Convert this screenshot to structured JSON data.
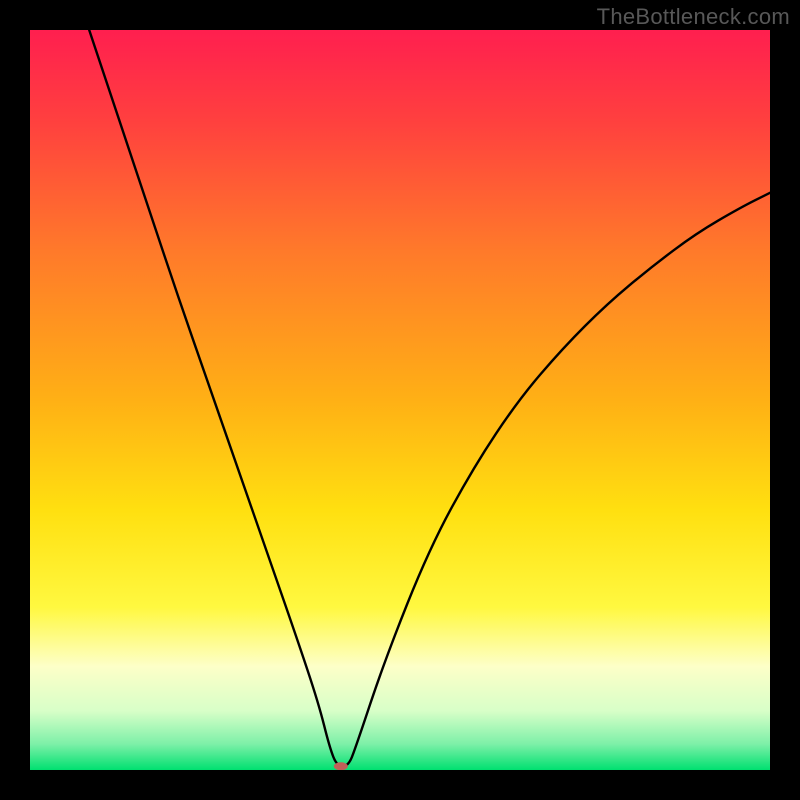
{
  "watermark": "TheBottleneck.com",
  "chart_data": {
    "type": "line",
    "title": "",
    "xlabel": "",
    "ylabel": "",
    "xlim": [
      0,
      100
    ],
    "ylim": [
      0,
      100
    ],
    "grid": false,
    "legend": false,
    "background_gradient_stops": [
      {
        "offset": 0.0,
        "color": "#ff1f4f"
      },
      {
        "offset": 0.12,
        "color": "#ff3f3f"
      },
      {
        "offset": 0.3,
        "color": "#ff7a2a"
      },
      {
        "offset": 0.5,
        "color": "#ffb015"
      },
      {
        "offset": 0.65,
        "color": "#ffe010"
      },
      {
        "offset": 0.78,
        "color": "#fff840"
      },
      {
        "offset": 0.86,
        "color": "#fdffc8"
      },
      {
        "offset": 0.92,
        "color": "#d8ffc8"
      },
      {
        "offset": 0.965,
        "color": "#7df0a8"
      },
      {
        "offset": 1.0,
        "color": "#00e070"
      }
    ],
    "series": [
      {
        "name": "bottleneck-curve",
        "x": [
          8,
          12,
          16,
          20,
          24,
          28,
          32,
          36,
          39,
          40.5,
          41.5,
          43,
          44,
          48,
          54,
          60,
          66,
          72,
          78,
          84,
          90,
          96,
          100
        ],
        "y": [
          100,
          88,
          76,
          64,
          52.5,
          41,
          29.5,
          18,
          9,
          3,
          0.5,
          0.5,
          3,
          15,
          30,
          41,
          50,
          57,
          63,
          68,
          72.5,
          76,
          78
        ]
      }
    ],
    "marker": {
      "name": "optimal-point",
      "x": 42,
      "y": 0.5,
      "color": "#c06058",
      "rx": 7,
      "ry": 4
    }
  }
}
